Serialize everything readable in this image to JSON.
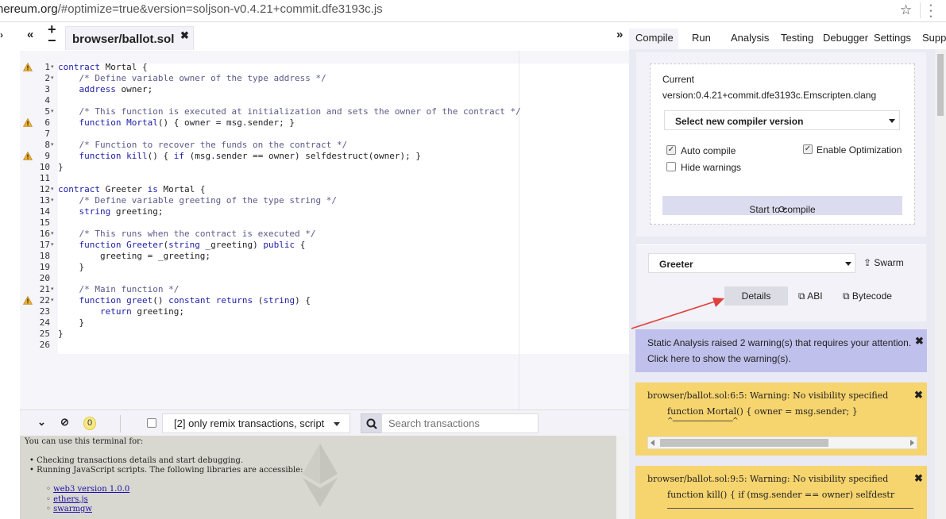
{
  "browser": {
    "url_host": "hereum.org",
    "url_rest": "/#optimize=true&version=soljson-v0.4.21+commit.dfe3193c.js"
  },
  "editor": {
    "tab_name": "browser/ballot.sol",
    "lines": [
      {
        "n": "1",
        "fold": true,
        "warn": true,
        "tokens": [
          [
            "kw",
            "contract"
          ],
          [
            "tx",
            " Mortal {"
          ]
        ]
      },
      {
        "n": "2",
        "fold": true,
        "warn": false,
        "tokens": [
          [
            "tx",
            "    "
          ],
          [
            "cm",
            "/* Define variable owner of the type address */"
          ]
        ]
      },
      {
        "n": "3",
        "fold": false,
        "warn": false,
        "tokens": [
          [
            "tx",
            "    "
          ],
          [
            "kw",
            "address"
          ],
          [
            "tx",
            " owner;"
          ]
        ]
      },
      {
        "n": "4",
        "fold": false,
        "warn": false,
        "tokens": []
      },
      {
        "n": "5",
        "fold": true,
        "warn": false,
        "tokens": [
          [
            "tx",
            "    "
          ],
          [
            "cm",
            "/* This function is executed at initialization and sets the owner of the contract */"
          ]
        ]
      },
      {
        "n": "6",
        "fold": false,
        "warn": true,
        "tokens": [
          [
            "tx",
            "    "
          ],
          [
            "kw",
            "function"
          ],
          [
            "tx",
            " "
          ],
          [
            "kw",
            "Mortal"
          ],
          [
            "tx",
            "() { owner = msg.sender; }"
          ]
        ]
      },
      {
        "n": "7",
        "fold": false,
        "warn": false,
        "tokens": []
      },
      {
        "n": "8",
        "fold": true,
        "warn": false,
        "tokens": [
          [
            "tx",
            "    "
          ],
          [
            "cm",
            "/* Function to recover the funds on the contract */"
          ]
        ]
      },
      {
        "n": "9",
        "fold": false,
        "warn": true,
        "tokens": [
          [
            "tx",
            "    "
          ],
          [
            "kw",
            "function"
          ],
          [
            "tx",
            " "
          ],
          [
            "kw",
            "kill"
          ],
          [
            "tx",
            "() { "
          ],
          [
            "kw",
            "if"
          ],
          [
            "tx",
            " (msg.sender == owner) selfdestruct(owner); }"
          ]
        ]
      },
      {
        "n": "10",
        "fold": false,
        "warn": false,
        "tokens": [
          [
            "tx",
            "}"
          ]
        ]
      },
      {
        "n": "11",
        "fold": false,
        "warn": false,
        "tokens": []
      },
      {
        "n": "12",
        "fold": true,
        "warn": false,
        "tokens": [
          [
            "kw",
            "contract"
          ],
          [
            "tx",
            " Greeter "
          ],
          [
            "kw",
            "is"
          ],
          [
            "tx",
            " Mortal {"
          ]
        ]
      },
      {
        "n": "13",
        "fold": true,
        "warn": false,
        "tokens": [
          [
            "tx",
            "    "
          ],
          [
            "cm",
            "/* Define variable greeting of the type string */"
          ]
        ]
      },
      {
        "n": "14",
        "fold": false,
        "warn": false,
        "tokens": [
          [
            "tx",
            "    "
          ],
          [
            "kw",
            "string"
          ],
          [
            "tx",
            " greeting;"
          ]
        ]
      },
      {
        "n": "15",
        "fold": false,
        "warn": false,
        "tokens": []
      },
      {
        "n": "16",
        "fold": true,
        "warn": false,
        "tokens": [
          [
            "tx",
            "    "
          ],
          [
            "cm",
            "/* This runs when the contract is executed */"
          ]
        ]
      },
      {
        "n": "17",
        "fold": true,
        "warn": false,
        "tokens": [
          [
            "tx",
            "    "
          ],
          [
            "kw",
            "function"
          ],
          [
            "tx",
            " "
          ],
          [
            "kw",
            "Greeter"
          ],
          [
            "tx",
            "("
          ],
          [
            "kw",
            "string"
          ],
          [
            "tx",
            " _greeting) "
          ],
          [
            "kw",
            "public"
          ],
          [
            "tx",
            " {"
          ]
        ]
      },
      {
        "n": "18",
        "fold": false,
        "warn": false,
        "tokens": [
          [
            "tx",
            "        greeting = _greeting;"
          ]
        ]
      },
      {
        "n": "19",
        "fold": false,
        "warn": false,
        "tokens": [
          [
            "tx",
            "    }"
          ]
        ]
      },
      {
        "n": "20",
        "fold": false,
        "warn": false,
        "tokens": []
      },
      {
        "n": "21",
        "fold": true,
        "warn": false,
        "tokens": [
          [
            "tx",
            "    "
          ],
          [
            "cm",
            "/* Main function */"
          ]
        ]
      },
      {
        "n": "22",
        "fold": true,
        "warn": true,
        "tokens": [
          [
            "tx",
            "    "
          ],
          [
            "kw",
            "function"
          ],
          [
            "tx",
            " "
          ],
          [
            "kw",
            "greet"
          ],
          [
            "tx",
            "() "
          ],
          [
            "kw",
            "constant"
          ],
          [
            "tx",
            " "
          ],
          [
            "kw",
            "returns"
          ],
          [
            "tx",
            " ("
          ],
          [
            "kw",
            "string"
          ],
          [
            "tx",
            ") {"
          ]
        ]
      },
      {
        "n": "23",
        "fold": false,
        "warn": false,
        "tokens": [
          [
            "tx",
            "        "
          ],
          [
            "kw",
            "return"
          ],
          [
            "tx",
            " greeting;"
          ]
        ]
      },
      {
        "n": "24",
        "fold": false,
        "warn": false,
        "tokens": [
          [
            "tx",
            "    }"
          ]
        ]
      },
      {
        "n": "25",
        "fold": false,
        "warn": false,
        "tokens": [
          [
            "tx",
            "}"
          ]
        ]
      },
      {
        "n": "26",
        "fold": false,
        "warn": false,
        "tokens": []
      }
    ]
  },
  "terminal": {
    "badge_count": "0",
    "filter_label": "[2] only remix transactions, script",
    "search_placeholder": "Search transactions",
    "intro": "You can use this terminal for:",
    "bullet1": "Checking transactions details and start debugging.",
    "bullet2": "Running JavaScript scripts. The following libraries are accessible:",
    "link1": "web3 version 1.0.0",
    "link2": "ethers.js",
    "link3": "swarmgw"
  },
  "right_tabs": {
    "compile": "Compile",
    "run": "Run",
    "analysis": "Analysis",
    "testing": "Testing",
    "debugger": "Debugger",
    "settings": "Settings",
    "support": "Supp"
  },
  "compiler": {
    "current_label": "Current",
    "version": "version:0.4.21+commit.dfe3193c.Emscripten.clang",
    "select_label": "Select new compiler version",
    "auto_compile": "Auto compile",
    "auto_compile_checked": true,
    "enable_optimization": "Enable Optimization",
    "enable_optimization_checked": true,
    "hide_warnings": "Hide warnings",
    "hide_warnings_checked": false,
    "compile_button": "Start to compile"
  },
  "contract": {
    "selected": "Greeter",
    "swarm": "Swarm",
    "details": "Details",
    "abi": "ABI",
    "bytecode": "Bytecode"
  },
  "analysis_alert": {
    "line1": "Static Analysis raised 2 warning(s) that requires your attention.",
    "line2": "Click here to show the warning(s)."
  },
  "warnings": [
    {
      "head": "browser/ballot.sol:6:5: Warning: No visibility specified",
      "code": "function Mortal() { owner = msg.sender; }",
      "marker": "^-------------------------------------^"
    },
    {
      "head": "browser/ballot.sol:9:5: Warning: No visibility specified",
      "code": "function kill() { if (msg.sender == owner) selfdestr"
    }
  ],
  "colors": {
    "accent": "#c0c0ec",
    "warning_bg": "#f6d46e",
    "keyword": "#2020a8",
    "comment": "#5a5a8a",
    "annotation_arrow": "#e0413a"
  }
}
